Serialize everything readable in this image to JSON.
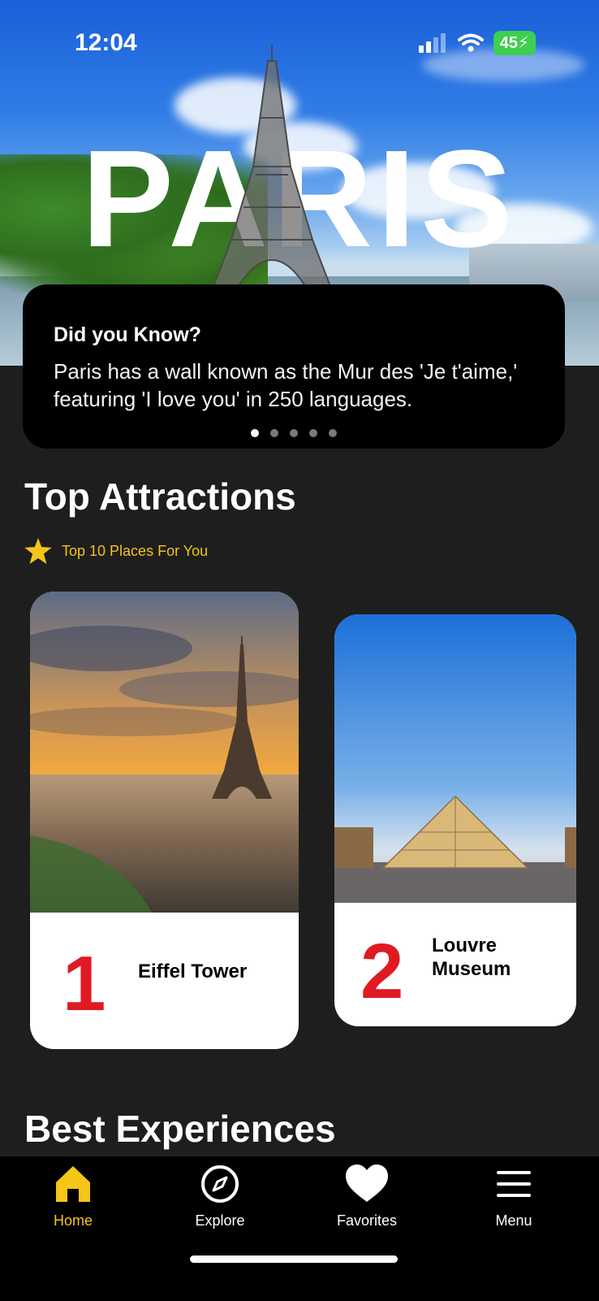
{
  "status_bar": {
    "time": "12:04",
    "battery": "45"
  },
  "hero": {
    "city_title": "PARIS"
  },
  "fact_card": {
    "title": "Did you Know?",
    "text": "Paris has a wall known as the Mur des 'Je t'aime,' featuring 'I love you' in 250 languages.",
    "total_pages": 5,
    "active_page": 1
  },
  "top_attractions": {
    "title": "Top Attractions",
    "subtitle": "Top 10 Places For You",
    "cards": [
      {
        "rank": "1",
        "name": "Eiffel Tower"
      },
      {
        "rank": "2",
        "name": "Louvre Museum"
      }
    ]
  },
  "best_experiences": {
    "title": "Best Experiences"
  },
  "tab_bar": {
    "items": [
      {
        "label": "Home",
        "icon": "home-icon",
        "active": true
      },
      {
        "label": "Explore",
        "icon": "compass-icon",
        "active": false
      },
      {
        "label": "Favorites",
        "icon": "heart-icon",
        "active": false
      },
      {
        "label": "Menu",
        "icon": "menu-icon",
        "active": false
      }
    ]
  },
  "colors": {
    "accent": "#F5C518",
    "rank": "#E01A23",
    "background": "#1E1E1E"
  }
}
